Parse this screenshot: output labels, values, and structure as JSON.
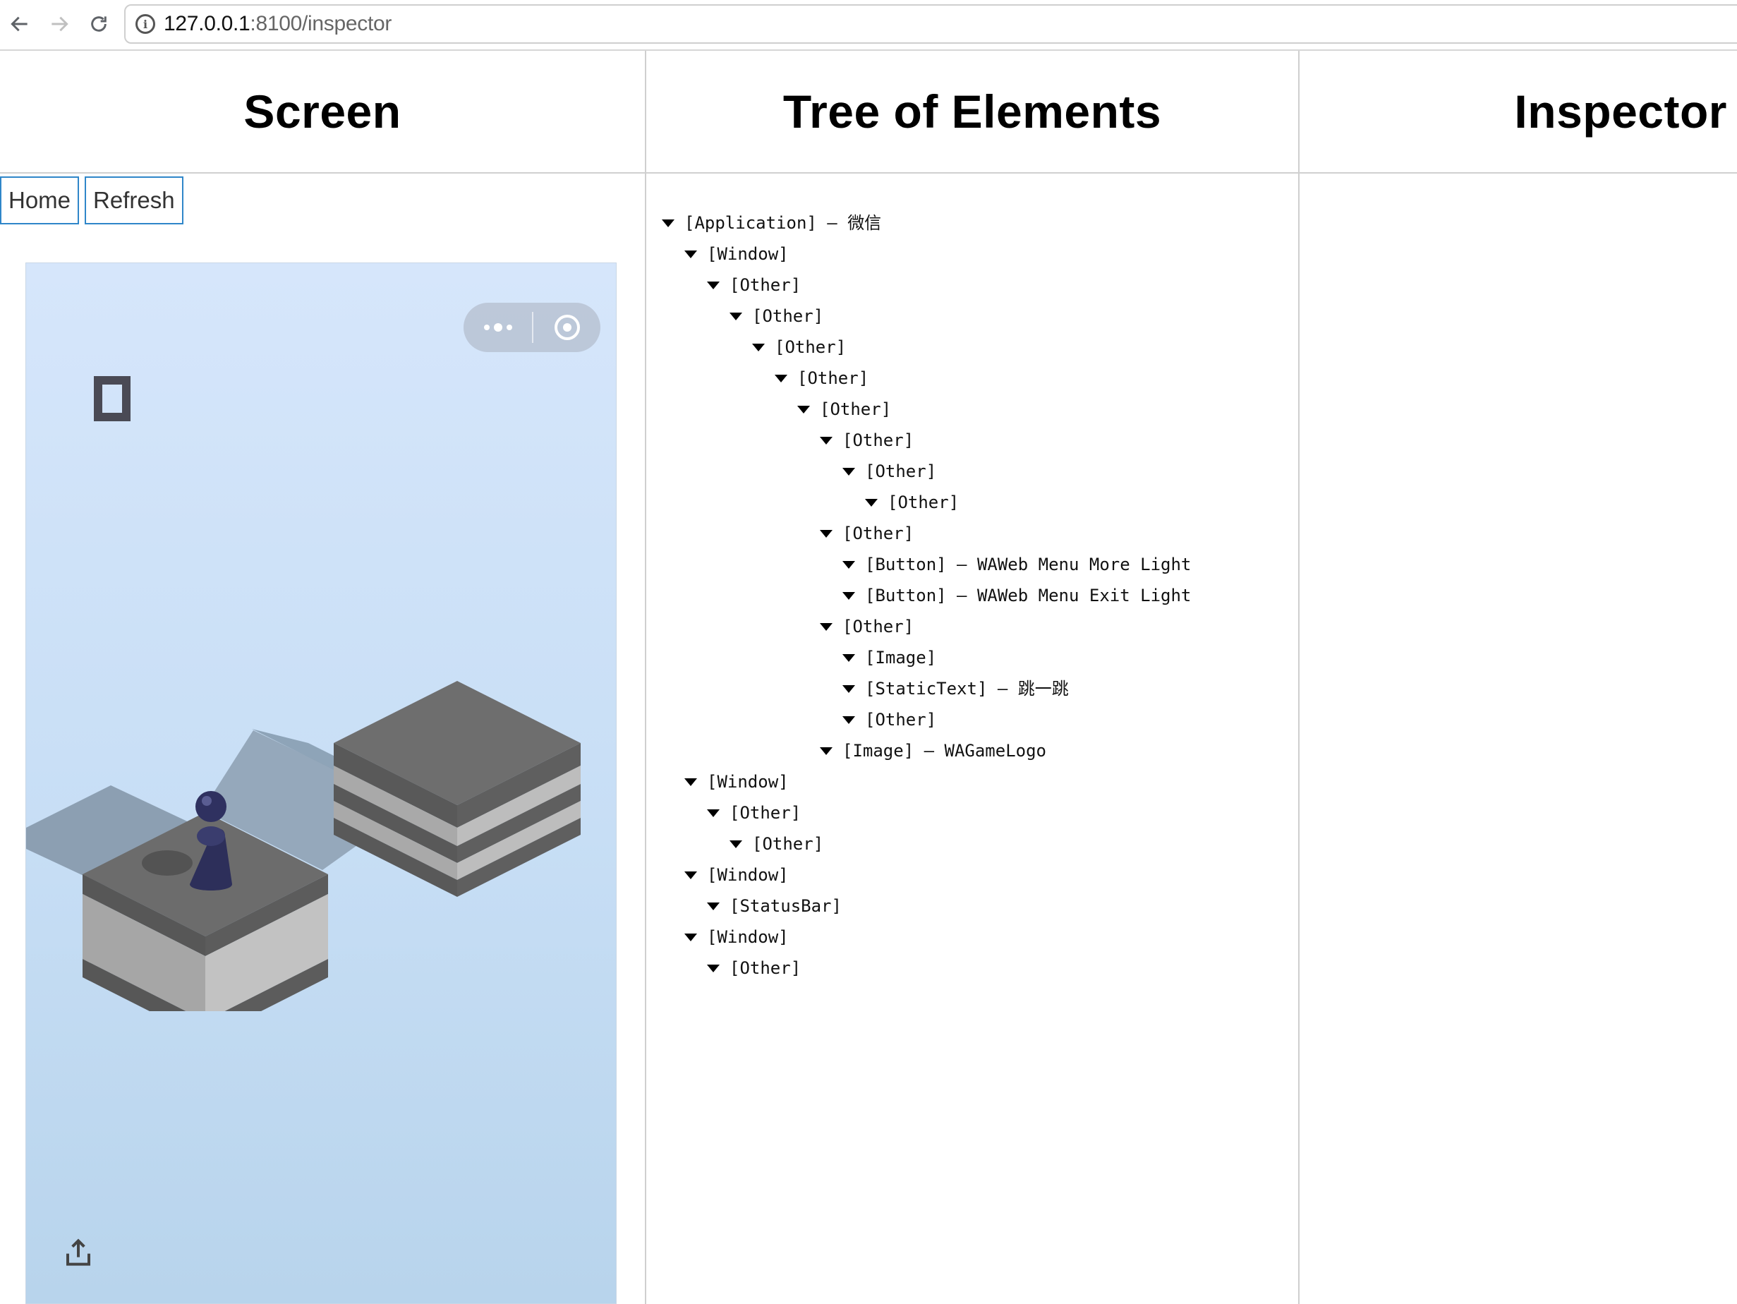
{
  "browser": {
    "url_host": "127.0.0.1",
    "url_path": ":8100/inspector",
    "back_icon": "arrow-left-icon",
    "forward_icon": "arrow-right-icon",
    "reload_icon": "reload-icon",
    "info_icon": "info-icon"
  },
  "columns": {
    "screen_title": "Screen",
    "tree_title": "Tree of Elements",
    "inspector_title": "Inspector"
  },
  "screen": {
    "home_label": "Home",
    "refresh_label": "Refresh"
  },
  "tree": [
    {
      "depth": 0,
      "label": "[Application] – 微信"
    },
    {
      "depth": 1,
      "label": "[Window]"
    },
    {
      "depth": 2,
      "label": "[Other]"
    },
    {
      "depth": 3,
      "label": "[Other]"
    },
    {
      "depth": 4,
      "label": "[Other]"
    },
    {
      "depth": 5,
      "label": "[Other]"
    },
    {
      "depth": 6,
      "label": "[Other]"
    },
    {
      "depth": 7,
      "label": "[Other]"
    },
    {
      "depth": 8,
      "label": "[Other]"
    },
    {
      "depth": 9,
      "label": "[Other]"
    },
    {
      "depth": 7,
      "label": "[Other]"
    },
    {
      "depth": 8,
      "label": "[Button] – WAWeb Menu More Light"
    },
    {
      "depth": 8,
      "label": "[Button] – WAWeb Menu Exit Light"
    },
    {
      "depth": 7,
      "label": "[Other]"
    },
    {
      "depth": 8,
      "label": "[Image]"
    },
    {
      "depth": 8,
      "label": "[StaticText] – 跳一跳"
    },
    {
      "depth": 8,
      "label": "[Other]"
    },
    {
      "depth": 7,
      "label": "[Image] – WAGameLogo"
    },
    {
      "depth": 1,
      "label": "[Window]"
    },
    {
      "depth": 2,
      "label": "[Other]"
    },
    {
      "depth": 3,
      "label": "[Other]"
    },
    {
      "depth": 1,
      "label": "[Window]"
    },
    {
      "depth": 2,
      "label": "[StatusBar]"
    },
    {
      "depth": 1,
      "label": "[Window]"
    },
    {
      "depth": 2,
      "label": "[Other]"
    }
  ]
}
